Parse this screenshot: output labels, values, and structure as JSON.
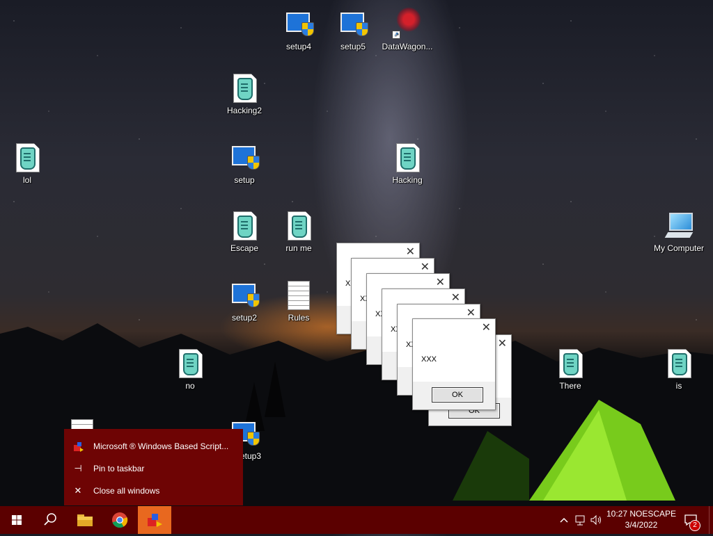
{
  "desktop": {
    "icons": [
      {
        "id": "setup4",
        "label": "setup4",
        "kind": "setup"
      },
      {
        "id": "setup5",
        "label": "setup5",
        "kind": "setup"
      },
      {
        "id": "datawagon",
        "label": "DataWagon...",
        "kind": "shortcut"
      },
      {
        "id": "hacking2",
        "label": "Hacking2",
        "kind": "script"
      },
      {
        "id": "lol",
        "label": "lol",
        "kind": "script"
      },
      {
        "id": "setup",
        "label": "setup",
        "kind": "setup"
      },
      {
        "id": "hacking",
        "label": "Hacking",
        "kind": "script"
      },
      {
        "id": "escape",
        "label": "Escape",
        "kind": "script"
      },
      {
        "id": "runme",
        "label": "run me",
        "kind": "script"
      },
      {
        "id": "mycomputer",
        "label": "My Computer",
        "kind": "computer"
      },
      {
        "id": "setup2",
        "label": "setup2",
        "kind": "setup"
      },
      {
        "id": "rules",
        "label": "Rules",
        "kind": "text"
      },
      {
        "id": "no",
        "label": "no",
        "kind": "script"
      },
      {
        "id": "there",
        "label": "There",
        "kind": "script"
      },
      {
        "id": "is",
        "label": "is",
        "kind": "script"
      },
      {
        "id": "setup3",
        "label": "etup3",
        "kind": "setup"
      }
    ]
  },
  "dialogs": {
    "message": "XXX",
    "message_partial": "XX",
    "ok_label": "OK",
    "ok_partial_label": "OK",
    "close_glyph": "✕"
  },
  "jumplist": {
    "app_title": "Microsoft ® Windows Based Script...",
    "pin_label": "Pin to taskbar",
    "close_label": "Close all windows"
  },
  "taskbar": {
    "time": "10:27 NOESCAPE",
    "date": "3/4/2022",
    "notification_count": "2",
    "colors": {
      "bar": "#5b0000",
      "active": "#e8681f",
      "jumplist": "#6e0404"
    }
  }
}
